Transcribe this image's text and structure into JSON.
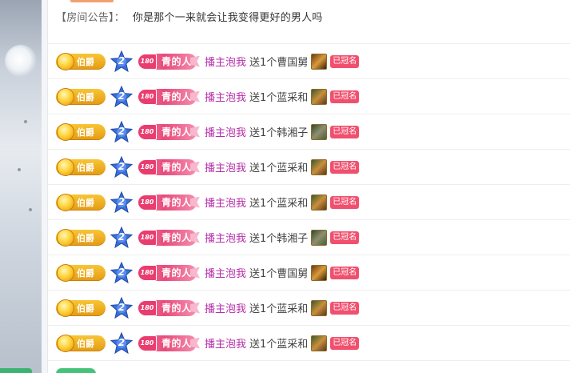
{
  "announcement": {
    "label": "【房间公告】：",
    "text": "你是那个一来就会让我变得更好的男人吗"
  },
  "messages": [
    {
      "noble": "伯爵",
      "level": "2",
      "fan_level": "180",
      "fan_name": "青的人",
      "user": "播主泡我",
      "action": "送1个曹国舅",
      "gift": "曹国舅",
      "tag": "已冠名"
    },
    {
      "noble": "伯爵",
      "level": "2",
      "fan_level": "180",
      "fan_name": "青的人",
      "user": "播主泡我",
      "action": "送1个蓝采和",
      "gift": "蓝采和",
      "tag": "已冠名"
    },
    {
      "noble": "伯爵",
      "level": "2",
      "fan_level": "180",
      "fan_name": "青的人",
      "user": "播主泡我",
      "action": "送1个韩湘子",
      "gift": "韩湘子",
      "tag": "已冠名"
    },
    {
      "noble": "伯爵",
      "level": "2",
      "fan_level": "180",
      "fan_name": "青的人",
      "user": "播主泡我",
      "action": "送1个蓝采和",
      "gift": "蓝采和",
      "tag": "已冠名"
    },
    {
      "noble": "伯爵",
      "level": "2",
      "fan_level": "180",
      "fan_name": "青的人",
      "user": "播主泡我",
      "action": "送1个蓝采和",
      "gift": "蓝采和",
      "tag": "已冠名"
    },
    {
      "noble": "伯爵",
      "level": "2",
      "fan_level": "180",
      "fan_name": "青的人",
      "user": "播主泡我",
      "action": "送1个韩湘子",
      "gift": "韩湘子",
      "tag": "已冠名"
    },
    {
      "noble": "伯爵",
      "level": "2",
      "fan_level": "180",
      "fan_name": "青的人",
      "user": "播主泡我",
      "action": "送1个曹国舅",
      "gift": "曹国舅",
      "tag": "已冠名"
    },
    {
      "noble": "伯爵",
      "level": "2",
      "fan_level": "180",
      "fan_name": "青的人",
      "user": "播主泡我",
      "action": "送1个蓝采和",
      "gift": "蓝采和",
      "tag": "已冠名"
    },
    {
      "noble": "伯爵",
      "level": "2",
      "fan_level": "180",
      "fan_name": "青的人",
      "user": "播主泡我",
      "action": "送1个蓝采和",
      "gift": "蓝采和",
      "tag": "已冠名"
    }
  ],
  "partial_row": {
    "text_a": "",
    "text_b": ""
  },
  "colors": {
    "username": "#b52ea9",
    "noble_gold": "#e59a12",
    "fan_pink": "#e84a7a",
    "named_tag": "#f0506e",
    "level_star": "#3a6fd8"
  },
  "icons": {
    "noble": "gold-coin-icon",
    "level": "blue-star-icon",
    "fan": "pink-heart-icon",
    "gift": "gift-thumbnail-icon"
  }
}
